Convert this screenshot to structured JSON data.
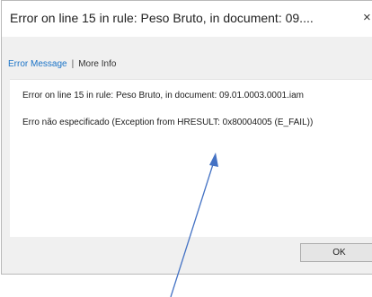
{
  "dialog": {
    "title": "Error on line 15 in rule: Peso Bruto, in document: 09....",
    "close_glyph": "×",
    "tabs": [
      {
        "label": "Error Message"
      },
      {
        "label": "More Info"
      }
    ],
    "tab_separator": "|",
    "messages": [
      "Error on line 15 in rule: Peso Bruto, in document: 09.01.0003.0001.iam",
      "Erro não especificado (Exception from HRESULT: 0x80004005 (E_FAIL))"
    ],
    "ok_label": "OK"
  },
  "annotation": {
    "arrow_color": "#4472c4"
  }
}
